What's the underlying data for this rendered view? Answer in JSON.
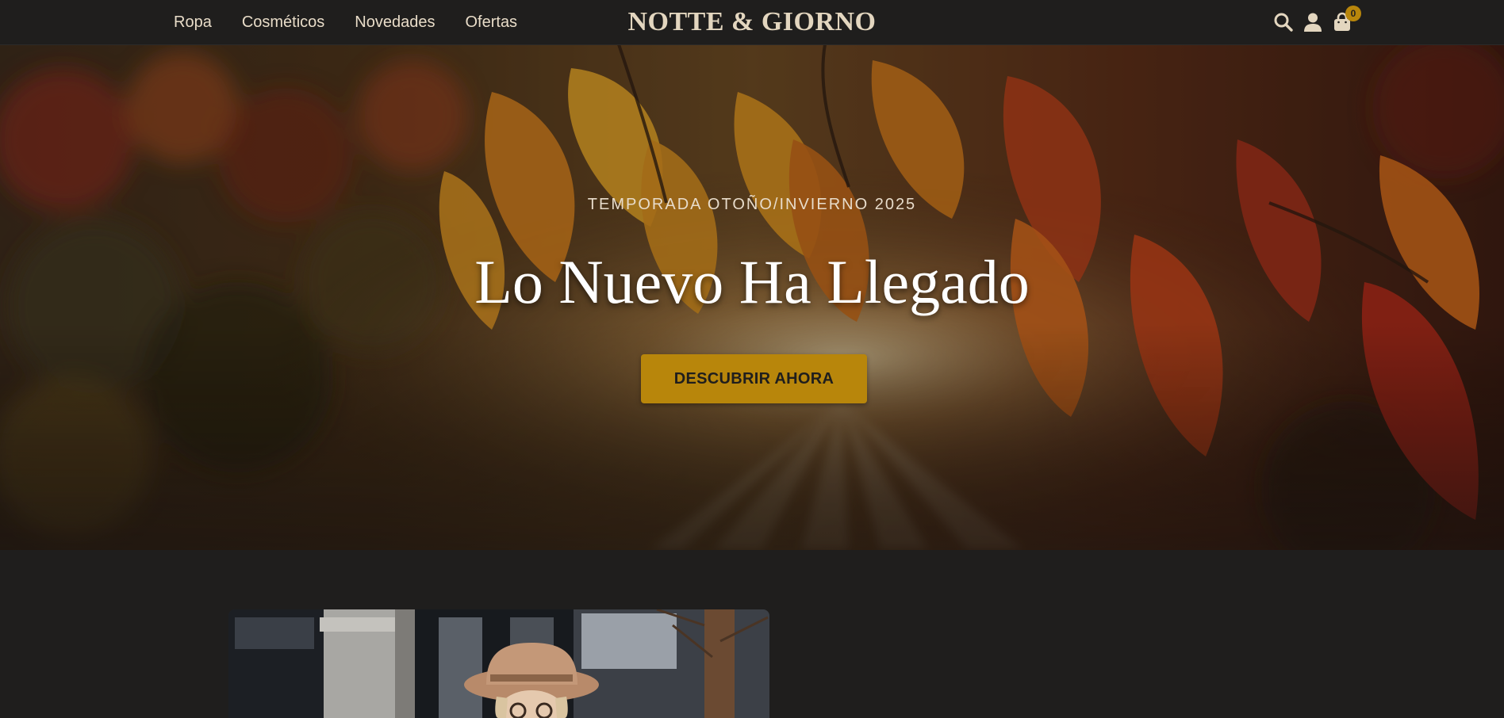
{
  "header": {
    "nav": [
      {
        "label": "Ropa"
      },
      {
        "label": "Cosméticos"
      },
      {
        "label": "Novedades"
      },
      {
        "label": "Ofertas"
      }
    ],
    "brand": "NOTTE & GIORNO",
    "icons": {
      "search": "search-icon",
      "account": "user-icon",
      "cart": "shopping-bag-icon"
    },
    "cart_count": "0"
  },
  "hero": {
    "eyebrow": "TEMPORADA OTOÑO/INVIERNO 2025",
    "title": "Lo Nuevo Ha Llegado",
    "cta_label": "DESCUBRIR AHORA",
    "background_image": "autumn-leaves-sunlight"
  },
  "featured": {
    "image": "woman-in-hat-street-photo"
  },
  "colors": {
    "background": "#1f1e1d",
    "accent": "#b8860b",
    "nav_text": "#e8dcc8",
    "brand_text": "#e3d6bf"
  }
}
